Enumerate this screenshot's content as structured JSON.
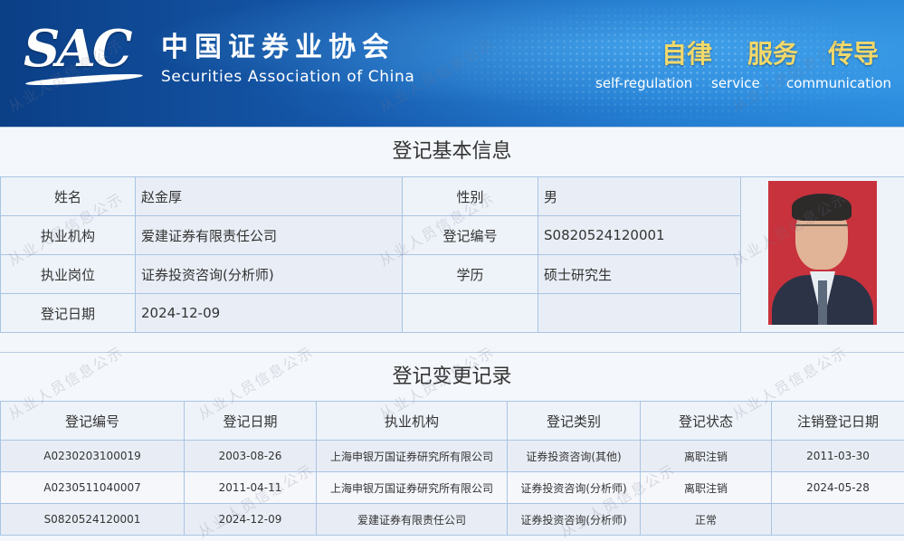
{
  "header": {
    "logo_text": "SAC",
    "org_name_cn": "中国证券业协会",
    "org_name_en": "Securities Association of China",
    "slogans": [
      {
        "cn": "自律",
        "en": "self-regulation"
      },
      {
        "cn": "服务",
        "en": "service"
      },
      {
        "cn": "传导",
        "en": "communication"
      }
    ]
  },
  "basic_info": {
    "title": "登记基本信息",
    "name_label": "姓名",
    "name_value": "赵金厚",
    "gender_label": "性别",
    "gender_value": "男",
    "org_label": "执业机构",
    "org_value": "爱建证券有限责任公司",
    "reg_no_label": "登记编号",
    "reg_no_value": "S0820524120001",
    "position_label": "执业岗位",
    "position_value": "证券投资咨询(分析师)",
    "education_label": "学历",
    "education_value": "硕士研究生",
    "reg_date_label": "登记日期",
    "reg_date_value": "2024-12-09"
  },
  "change_records": {
    "title": "登记变更记录",
    "columns": [
      "登记编号",
      "登记日期",
      "执业机构",
      "登记类别",
      "登记状态",
      "注销登记日期"
    ],
    "rows": [
      [
        "A0230203100019",
        "2003-08-26",
        "上海申银万国证券研究所有限公司",
        "证券投资咨询(其他)",
        "离职注销",
        "2011-03-30"
      ],
      [
        "A0230511040007",
        "2011-04-11",
        "上海申银万国证券研究所有限公司",
        "证券投资咨询(分析师)",
        "离职注销",
        "2024-05-28"
      ],
      [
        "S0820524120001",
        "2024-12-09",
        "爱建证券有限责任公司",
        "证券投资咨询(分析师)",
        "正常",
        ""
      ]
    ]
  },
  "watermark_text": "从业人员信息公示",
  "colors": {
    "banner_blue": "#1659ac",
    "slogan_gold": "#f2d96a",
    "table_border": "#a9c4e2"
  }
}
